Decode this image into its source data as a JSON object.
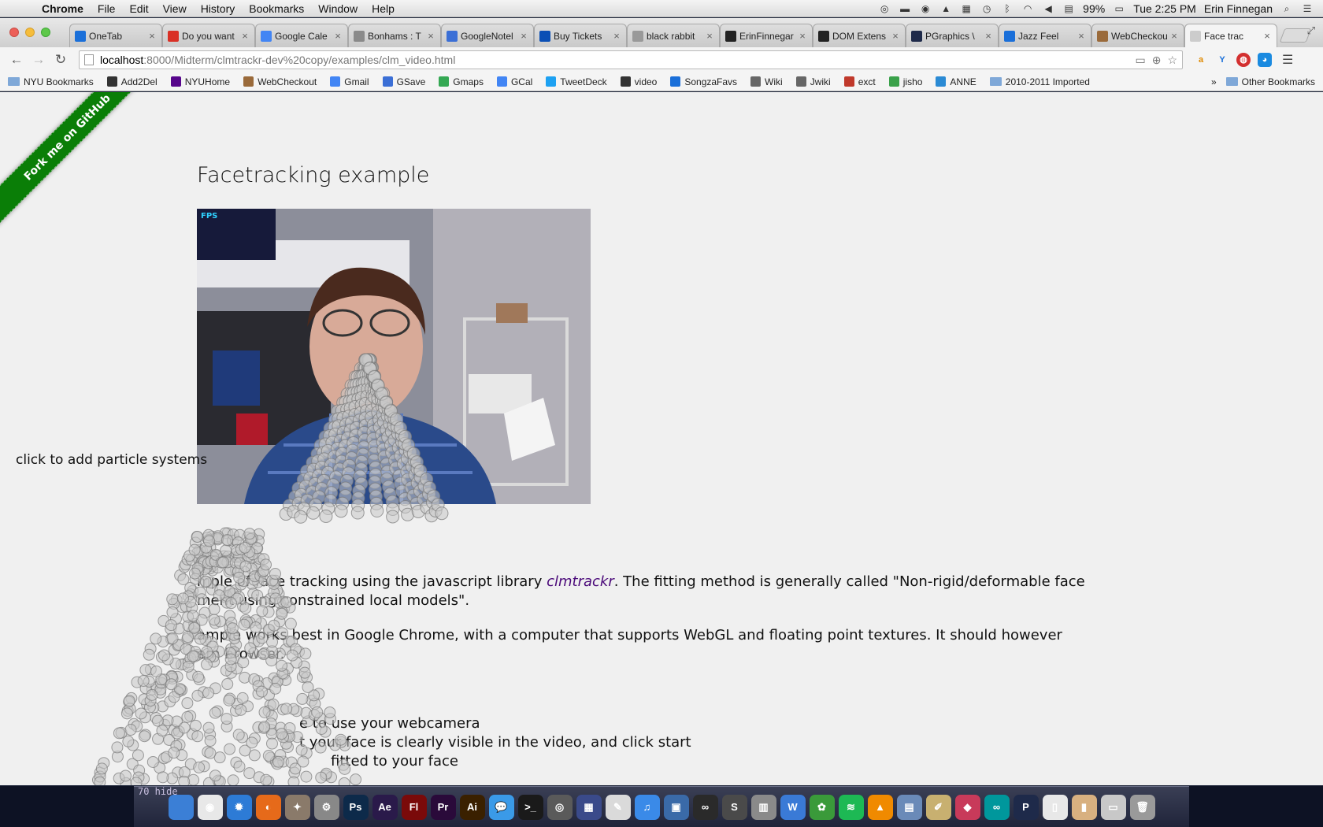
{
  "menubar": {
    "app": "Chrome",
    "items": [
      "File",
      "Edit",
      "View",
      "History",
      "Bookmarks",
      "Window",
      "Help"
    ],
    "battery": "99%",
    "clock": "Tue 2:25 PM",
    "user": "Erin Finnegan"
  },
  "tabs": [
    {
      "title": "OneTab",
      "color": "#1a6fd9"
    },
    {
      "title": "Do you want",
      "color": "#d93025"
    },
    {
      "title": "Google Cale",
      "color": "#4285f4"
    },
    {
      "title": "Bonhams : T",
      "color": "#8a8a8a"
    },
    {
      "title": "GoogleNotel",
      "color": "#3b6fd6"
    },
    {
      "title": "Buy Tickets",
      "color": "#0a4fb5"
    },
    {
      "title": "black rabbit",
      "color": "#999999"
    },
    {
      "title": "ErinFinnegar",
      "color": "#222222"
    },
    {
      "title": "DOM Extens",
      "color": "#222222"
    },
    {
      "title": "PGraphics \\",
      "color": "#1e2a4a"
    },
    {
      "title": "Jazz Feel",
      "color": "#1a6fd9"
    },
    {
      "title": "WebCheckou",
      "color": "#9a6a3a"
    },
    {
      "title": "Face trac",
      "color": "#cccccc"
    }
  ],
  "address": {
    "host": "localhost",
    "path": ":8000/Midterm/clmtrackr-dev%20copy/examples/clm_video.html"
  },
  "bookmarks": [
    {
      "label": "NYU Bookmarks",
      "folder": true,
      "color": "#7fa8d8"
    },
    {
      "label": "Add2Del",
      "folder": false,
      "color": "#333333"
    },
    {
      "label": "NYUHome",
      "folder": false,
      "color": "#57068c"
    },
    {
      "label": "WebCheckout",
      "folder": false,
      "color": "#9a6a3a"
    },
    {
      "label": "Gmail",
      "folder": false,
      "color": "#4285f4"
    },
    {
      "label": "GSave",
      "folder": false,
      "color": "#3b6fd6"
    },
    {
      "label": "Gmaps",
      "folder": false,
      "color": "#34a853"
    },
    {
      "label": "GCal",
      "folder": false,
      "color": "#4285f4"
    },
    {
      "label": "TweetDeck",
      "folder": false,
      "color": "#1da1f2"
    },
    {
      "label": "video",
      "folder": false,
      "color": "#333333"
    },
    {
      "label": "SongzaFavs",
      "folder": false,
      "color": "#1a6fd9"
    },
    {
      "label": "Wiki",
      "folder": false,
      "color": "#666666"
    },
    {
      "label": "Jwiki",
      "folder": false,
      "color": "#666666"
    },
    {
      "label": "exct",
      "folder": false,
      "color": "#c0392b"
    },
    {
      "label": "jisho",
      "folder": false,
      "color": "#3aa14a"
    },
    {
      "label": "ANNE",
      "folder": false,
      "color": "#2a8ad4"
    },
    {
      "label": "2010-2011 Imported",
      "folder": true,
      "color": "#7fa8d8"
    }
  ],
  "bookmarks_overflow": "»",
  "other_bookmarks": "Other Bookmarks",
  "page": {
    "ribbon": "Fork me on GitHub",
    "title": "Facetracking example",
    "fps_label": "FPS",
    "hint": "click to add particle systems",
    "para1_a": "mple of face tracking using the javascript library ",
    "para1_link": "clmtrackr",
    "para1_b": ". The fitting method is generally called \"Non-rigid/deformable face",
    "para1_c": "ment using constrained local models\".",
    "para2_a": "ample works best in Google Chrome, with a computer that supports WebGL and floating point textures. It should however",
    "para2_b": "ern browser.",
    "step1": "e to use your webcamera",
    "step2": "t your face is clearly visible in the video, and click start",
    "step3": "fitted to your face"
  },
  "dock": {
    "terminal_text": "70      hide",
    "apps": [
      {
        "name": "finder-icon",
        "color": "#3b7fd6",
        "glyph": ""
      },
      {
        "name": "chrome-icon",
        "color": "#e8e8e8",
        "glyph": "◉"
      },
      {
        "name": "safari-icon",
        "color": "#2d7bd6",
        "glyph": "✹"
      },
      {
        "name": "firefox-icon",
        "color": "#e66a1a",
        "glyph": "◐"
      },
      {
        "name": "cat-icon",
        "color": "#8a7a6a",
        "glyph": "✦"
      },
      {
        "name": "preferences-icon",
        "color": "#888888",
        "glyph": "⚙"
      },
      {
        "name": "photoshop-icon",
        "color": "#0d2a4a",
        "glyph": "Ps"
      },
      {
        "name": "aftereffects-icon",
        "color": "#2a1a4a",
        "glyph": "Ae"
      },
      {
        "name": "flash-icon",
        "color": "#7a0a0a",
        "glyph": "Fl"
      },
      {
        "name": "premiere-icon",
        "color": "#2a0a3a",
        "glyph": "Pr"
      },
      {
        "name": "illustrator-icon",
        "color": "#3a2000",
        "glyph": "Ai"
      },
      {
        "name": "messages-icon",
        "color": "#3a9ae8",
        "glyph": "💬"
      },
      {
        "name": "terminal-icon",
        "color": "#1a1a1a",
        "glyph": ">_"
      },
      {
        "name": "camera-icon",
        "color": "#5a5a5a",
        "glyph": "◎"
      },
      {
        "name": "launchpad-icon",
        "color": "#3a4a8a",
        "glyph": "▦"
      },
      {
        "name": "textedit-icon",
        "color": "#dadada",
        "glyph": "✎"
      },
      {
        "name": "itunes-icon",
        "color": "#3a8ae8",
        "glyph": "♫"
      },
      {
        "name": "preview-icon",
        "color": "#3a6aa8",
        "glyph": "▣"
      },
      {
        "name": "binoculars-icon",
        "color": "#2a2a2a",
        "glyph": "∞"
      },
      {
        "name": "sublime-icon",
        "color": "#4a4a4a",
        "glyph": "S"
      },
      {
        "name": "calculator-icon",
        "color": "#8a8a8a",
        "glyph": "▥"
      },
      {
        "name": "wunderlist-icon",
        "color": "#3a7ad6",
        "glyph": "W"
      },
      {
        "name": "growl-icon",
        "color": "#3a9a3a",
        "glyph": "✿"
      },
      {
        "name": "spotify-icon",
        "color": "#1db954",
        "glyph": "≋"
      },
      {
        "name": "vlc-icon",
        "color": "#f08a00",
        "glyph": "▲"
      },
      {
        "name": "photos-icon",
        "color": "#6a8ab8",
        "glyph": "▤"
      },
      {
        "name": "drawing-icon",
        "color": "#c8b070",
        "glyph": "✐"
      },
      {
        "name": "processing-icon",
        "color": "#c83a5a",
        "glyph": "◆"
      },
      {
        "name": "arduino-icon",
        "color": "#00979c",
        "glyph": "∞"
      },
      {
        "name": "pixelmator-icon",
        "color": "#1e2a4a",
        "glyph": "P"
      },
      {
        "name": "document-icon",
        "color": "#e8e8e8",
        "glyph": "▯"
      },
      {
        "name": "archive-icon",
        "color": "#d8b080",
        "glyph": "▮"
      },
      {
        "name": "downloads-icon",
        "color": "#c8c8c8",
        "glyph": "▭"
      },
      {
        "name": "trash-icon",
        "color": "#9a9a9a",
        "glyph": "🗑"
      }
    ]
  }
}
